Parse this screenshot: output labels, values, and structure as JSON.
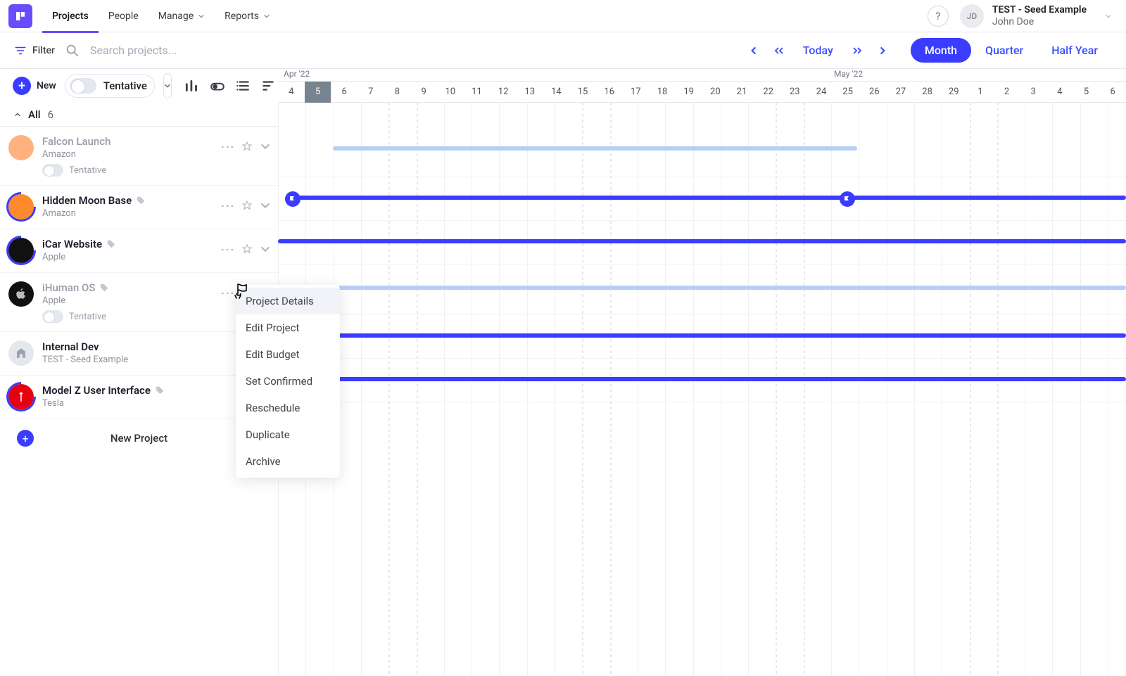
{
  "nav": {
    "projects": "Projects",
    "people": "People",
    "manage": "Manage",
    "reports": "Reports"
  },
  "user": {
    "initials": "JD",
    "org": "TEST - Seed Example",
    "name": "John Doe"
  },
  "toolbar": {
    "filter": "Filter",
    "search_ph": "Search projects...",
    "today": "Today"
  },
  "views": {
    "month": "Month",
    "quarter": "Quarter",
    "half": "Half Year"
  },
  "subbar": {
    "new": "New",
    "tentative": "Tentative"
  },
  "timeline": {
    "month_a": "Apr '22",
    "month_b": "May '22",
    "days": [
      "4",
      "5",
      "6",
      "7",
      "8",
      "9",
      "10",
      "11",
      "12",
      "13",
      "14",
      "15",
      "16",
      "17",
      "18",
      "19",
      "20",
      "21",
      "22",
      "23",
      "24",
      "25",
      "26",
      "27",
      "28",
      "29",
      "1",
      "2",
      "3",
      "4",
      "5",
      "6"
    ],
    "today_index": 1
  },
  "group": {
    "label": "All",
    "count": "6"
  },
  "projects": [
    {
      "name": "Falcon Launch",
      "client": "Amazon",
      "tentative": "Tentative",
      "muted": true,
      "toggle": true,
      "avatar_bg": "#FFB27D",
      "ring": false
    },
    {
      "name": "Hidden Moon Base",
      "client": "Amazon",
      "tag": true,
      "avatar_bg": "#FF8A2B",
      "ring": true
    },
    {
      "name": "iCar Website",
      "client": "Apple",
      "tag": true,
      "avatar_bg": "#111",
      "avatar_txt": "",
      "ring": true,
      "apple": true
    },
    {
      "name": "iHuman OS",
      "client": "Apple",
      "tag": true,
      "tentative": "Tentative",
      "muted": true,
      "toggle": true,
      "avatar_bg": "#111",
      "ring": false,
      "apple": true
    },
    {
      "name": "Internal Dev",
      "client": "TEST - Seed Example",
      "avatar_bg": "#e5e7ee",
      "build": true
    },
    {
      "name": "Model Z User Interface",
      "client": "Tesla",
      "tag": true,
      "avatar_bg": "#E60012",
      "ring": true,
      "tesla": true
    }
  ],
  "new_project": "New Project",
  "ctx": [
    "Project Details",
    "Edit Project",
    "Edit Budget",
    "Set Confirmed",
    "Reschedule",
    "Duplicate",
    "Archive"
  ]
}
